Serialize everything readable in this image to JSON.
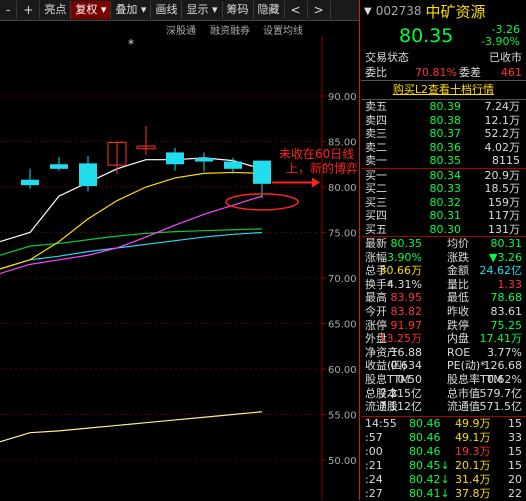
{
  "toolbar": {
    "items": [
      "-",
      "+",
      "亮点",
      "复权",
      "叠加",
      "画线",
      "显示",
      "筹码",
      "隐藏"
    ],
    "nav_prev": "<",
    "nav_next": ">"
  },
  "chart_tabs": [
    "深股通",
    "融资融券",
    "设置均线"
  ],
  "chart": {
    "y_ticks": [
      "90.00",
      "85.00",
      "80.00",
      "75.00",
      "70.00",
      "65.00",
      "60.00",
      "55.00",
      "50.00"
    ],
    "annotation_line1": "未收在60日线",
    "annotation_line2": "上，新的博弈点",
    "marker": "*"
  },
  "colors": {
    "up": "#ff3333",
    "down": "#00ff44",
    "ma5": "#ffffff",
    "ma10": "#ffdd00",
    "ma20": "#ff44ff",
    "ma30": "#00cc44",
    "ma60": "#22ddee"
  },
  "chart_data": {
    "type": "candlestick",
    "ylim": [
      50,
      92
    ],
    "candles": [
      {
        "o": 80.8,
        "h": 82.0,
        "l": 79.8,
        "c": 80.2
      },
      {
        "o": 82.5,
        "h": 83.3,
        "l": 81.8,
        "c": 82.0
      },
      {
        "o": 82.6,
        "h": 83.4,
        "l": 79.5,
        "c": 80.1
      },
      {
        "o": 82.4,
        "h": 85.0,
        "l": 81.4,
        "c": 84.9
      },
      {
        "o": 84.2,
        "h": 86.7,
        "l": 83.5,
        "c": 84.5
      },
      {
        "o": 83.8,
        "h": 84.3,
        "l": 81.8,
        "c": 82.5
      },
      {
        "o": 83.2,
        "h": 83.8,
        "l": 81.7,
        "c": 82.8
      },
      {
        "o": 82.8,
        "h": 83.2,
        "l": 81.5,
        "c": 82.0
      },
      {
        "o": 82.9,
        "h": 82.9,
        "l": 78.8,
        "c": 80.35
      }
    ],
    "ma5": [
      75.0,
      79.0,
      80.5,
      82.0,
      83.0,
      83.0,
      83.2,
      82.9,
      82.0
    ],
    "ma10": [
      72.0,
      74.0,
      76.5,
      78.5,
      80.0,
      81.0,
      81.5,
      81.6,
      81.5
    ],
    "ma20": [
      71.5,
      72.0,
      72.5,
      73.3,
      74.5,
      75.8,
      77.0,
      78.0,
      79.0
    ],
    "ma30": [
      73.5,
      73.8,
      74.2,
      74.6,
      74.9,
      75.1,
      75.2,
      75.3,
      75.4
    ],
    "ma60": [
      72.0,
      72.4,
      72.9,
      73.3,
      73.7,
      74.1,
      74.5,
      74.8,
      75.0
    ],
    "ma120": [
      53.0,
      53.2,
      53.5,
      53.8,
      54.1,
      54.4,
      54.7,
      55.0,
      55.3
    ]
  },
  "quote": {
    "code": "002738",
    "name": "中矿资源",
    "price": "80.35",
    "change": "-3.26",
    "change_pct": "-3.90%",
    "status_label": "交易状态",
    "status_value": "已收市",
    "webi_label": "委比",
    "webi_value": "70.81%",
    "weicha_label": "委差",
    "weicha_value": "461",
    "l2_link": "购买L2查看十档行情",
    "asks": [
      {
        "label": "卖五",
        "price": "80.39",
        "vol": "7.24万"
      },
      {
        "label": "卖四",
        "price": "80.38",
        "vol": "12.1万"
      },
      {
        "label": "卖三",
        "price": "80.37",
        "vol": "52.2万"
      },
      {
        "label": "卖二",
        "price": "80.36",
        "vol": "4.02万"
      },
      {
        "label": "卖一",
        "price": "80.35",
        "vol": "8115"
      }
    ],
    "bids": [
      {
        "label": "买一",
        "price": "80.34",
        "vol": "20.9万"
      },
      {
        "label": "买二",
        "price": "80.33",
        "vol": "18.5万"
      },
      {
        "label": "买三",
        "price": "80.32",
        "vol": "159万"
      },
      {
        "label": "买四",
        "price": "80.31",
        "vol": "117万"
      },
      {
        "label": "买五",
        "price": "80.30",
        "vol": "131万"
      }
    ],
    "stats": [
      {
        "l1": "最新",
        "v1": "80.35",
        "c1": "green",
        "l2": "均价",
        "v2": "80.31",
        "c2": "green"
      },
      {
        "l1": "涨幅",
        "v1": "-3.90%",
        "c1": "green",
        "l2": "涨跌",
        "v2": "▼3.26",
        "c2": "green"
      },
      {
        "l1": "总手",
        "v1": "30.66万",
        "c1": "yellow",
        "l2": "金额",
        "v2": "24.62亿",
        "c2": "cyan"
      },
      {
        "l1": "换手*",
        "v1": "4.31%",
        "c1": "white",
        "l2": "量比",
        "v2": "1.33",
        "c2": "red"
      },
      {
        "l1": "最高",
        "v1": "83.95",
        "c1": "red",
        "l2": "最低",
        "v2": "78.68",
        "c2": "green"
      },
      {
        "l1": "今开",
        "v1": "83.82",
        "c1": "red",
        "l2": "昨收",
        "v2": "83.61",
        "c2": "white"
      },
      {
        "l1": "涨停",
        "v1": "91.97",
        "c1": "red",
        "l2": "跌停",
        "v2": "75.25",
        "c2": "green"
      },
      {
        "l1": "外盘",
        "v1": "13.25万",
        "c1": "red",
        "l2": "内盘",
        "v2": "17.41万",
        "c2": "green"
      },
      {
        "l1": "净资产",
        "v1": "16.88",
        "c1": "white",
        "l2": "ROE",
        "v2": "3.77%",
        "c2": "white"
      },
      {
        "l1": "收益(四)",
        "v1": "0.634",
        "c1": "white",
        "l2": "PE(动)*",
        "v2": "126.68",
        "c2": "white"
      },
      {
        "l1": "股息TTM",
        "v1": "0.50",
        "c1": "white",
        "l2": "股息率TTM",
        "v2": "0.62%",
        "c2": "white"
      },
      {
        "l1": "总股本",
        "v1": "7.215亿",
        "c1": "white",
        "l2": "总市值",
        "v2": "579.7亿",
        "c2": "white"
      },
      {
        "l1": "流通股",
        "v1": "7.112亿",
        "c1": "white",
        "l2": "流通值",
        "v2": "571.5亿",
        "c2": "white"
      }
    ],
    "ticks": [
      {
        "time": "14:55",
        "price": "80.46",
        "vol": "49.9万",
        "vcolor": "yellow",
        "n": "15"
      },
      {
        "time": ":57",
        "price": "80.46",
        "vol": "49.1万",
        "vcolor": "yellow",
        "n": "33"
      },
      {
        "time": ":00",
        "price": "80.46",
        "vol": "19.3万",
        "vcolor": "red",
        "n": "15"
      },
      {
        "time": ":21",
        "price": "80.45↓",
        "vol": "20.1万",
        "vcolor": "yellow",
        "n": "15"
      },
      {
        "time": ":24",
        "price": "80.42↓",
        "vol": "31.4万",
        "vcolor": "yellow",
        "n": "20"
      },
      {
        "time": ":27",
        "price": "80.41↓",
        "vol": "37.8万",
        "vcolor": "yellow",
        "n": "22"
      }
    ]
  }
}
